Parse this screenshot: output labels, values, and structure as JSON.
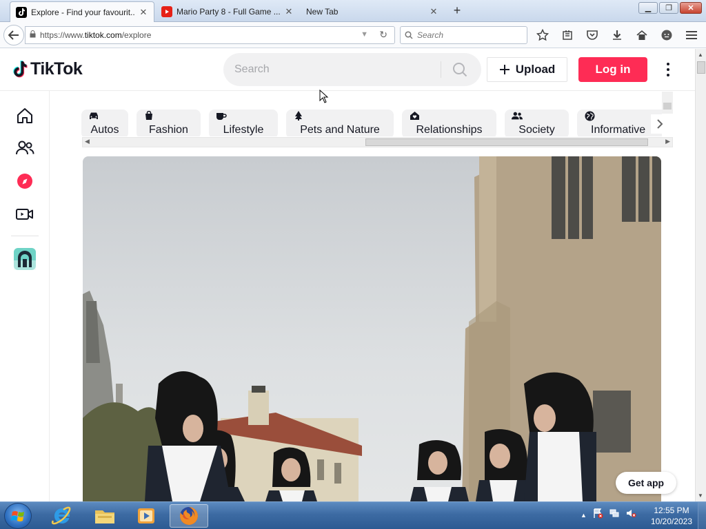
{
  "browser": {
    "tabs": [
      {
        "title": "Explore - Find your favourit...",
        "favicon": "tiktok-icon"
      },
      {
        "title": "Mario Party 8 - Full Game ...",
        "favicon": "youtube-icon"
      },
      {
        "title": "New Tab",
        "favicon": ""
      }
    ],
    "url_prefix": "https://www.",
    "url_host": "tiktok.com",
    "url_path": "/explore",
    "search_placeholder": "Search"
  },
  "tiktok": {
    "logo_text": "TikTok",
    "search_placeholder": "Search",
    "upload_label": "Upload",
    "login_label": "Log in",
    "brand_color": "#fe2c55",
    "sidebar": [
      "home-icon",
      "friends-icon",
      "explore-icon",
      "live-icon",
      "creator-avatar"
    ],
    "categories": [
      {
        "label": "Autos",
        "icon": "car-icon"
      },
      {
        "label": "Fashion",
        "icon": "bag-icon"
      },
      {
        "label": "Lifestyle",
        "icon": "cup-icon"
      },
      {
        "label": "Pets and Nature",
        "icon": "tree-icon"
      },
      {
        "label": "Relationships",
        "icon": "house-icon"
      },
      {
        "label": "Society",
        "icon": "people-icon"
      },
      {
        "label": "Informative",
        "icon": "globe-icon"
      }
    ],
    "get_app_label": "Get app"
  },
  "taskbar": {
    "time": "12:55 PM",
    "date": "10/20/2023"
  }
}
